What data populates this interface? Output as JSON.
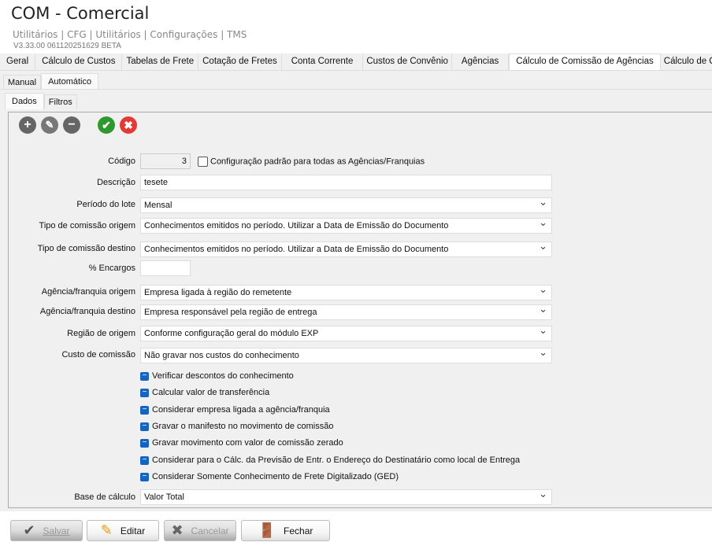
{
  "app": {
    "title": "COM - Comercial",
    "breadcrumb": "Utilitários | CFG | Utilitários | Configurações | TMS",
    "version": "V3.33.00 061120251629 BETA"
  },
  "main_tabs": [
    "Geral",
    "Cálculo de Custos",
    "Tabelas de Frete",
    "Cotação de Fretes",
    "Conta Corrente",
    "Custos de Convênio",
    "Agências",
    "Cálculo de Comissão de Agências",
    "Cálculo de Comissão"
  ],
  "sub_tabs": [
    "Manual",
    "Automático"
  ],
  "inner_tabs": [
    "Dados",
    "Filtros"
  ],
  "form": {
    "codigo_label": "Código",
    "codigo": "3",
    "padrao_label": "Configuração padrão para todas as Agências/Franquias",
    "descricao_label": "Descrição",
    "descricao": "tesete",
    "periodo_label": "Período do lote",
    "periodo": "Mensal",
    "tipo_origem_label": "Tipo de comissão origem",
    "tipo_origem": "Conhecimentos emitidos no período. Utilizar a Data de Emissão do Documento",
    "tipo_destino_label": "Tipo de comissão destino",
    "tipo_destino": "Conhecimentos emitidos no período. Utilizar a Data de Emissão do Documento",
    "encargos_label": "% Encargos",
    "encargos": "",
    "ag_origem_label": "Agência/franquia origem",
    "ag_origem": "Empresa ligada à região do remetente",
    "ag_destino_label": "Agência/franquia destino",
    "ag_destino": "Empresa responsável pela região de entrega",
    "regiao_label": "Região de origem",
    "regiao": "Conforme configuração geral do módulo EXP",
    "custo_label": "Custo de comissão",
    "custo": "Não gravar nos custos do conhecimento",
    "checks": [
      "Verificar descontos do conhecimento",
      "Calcular valor de transferência",
      "Considerar empresa ligada a agência/franquia",
      "Gravar o manifesto no movimento de comissão",
      "Gravar movimento com valor de comissão zerado",
      "Considerar para o Cálc. da Previsão de Entr. o Endereço do Destinatário como local de Entrega",
      "Considerar Somente Conhecimento de Frete Digitalizado (GED)"
    ],
    "base_label": "Base de cálculo",
    "base": "Valor Total"
  },
  "buttons": {
    "salvar": "Salvar",
    "editar": "Editar",
    "cancelar": "Cancelar",
    "fechar": "Fechar"
  }
}
